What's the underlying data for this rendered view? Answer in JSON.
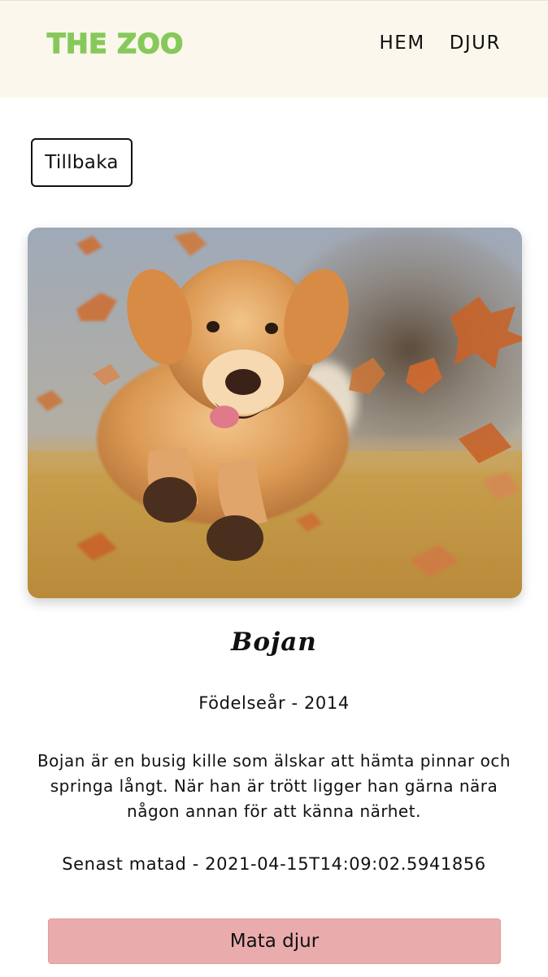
{
  "header": {
    "logo": "THE ZOO",
    "nav": [
      {
        "label": "HEM"
      },
      {
        "label": "DJUR"
      }
    ]
  },
  "back_button": {
    "label": "Tillbaka"
  },
  "animal": {
    "image_alt": "dog-running-in-autumn-leaves",
    "name": "Bojan",
    "birth_year_text": "Födelseår - 2014",
    "description": "Bojan är en busig kille som älskar att hämta pinnar och springa långt. När han är trött ligger han gärna nära någon annan för att känna närhet.",
    "last_fed_text": "Senast matad - 2021-04-15T14:09:02.5941856"
  },
  "feed_button": {
    "label": "Mata djur"
  },
  "colors": {
    "header_bg": "#fbf7ec",
    "logo": "#86c95a",
    "feed_button": "#eaabac"
  }
}
